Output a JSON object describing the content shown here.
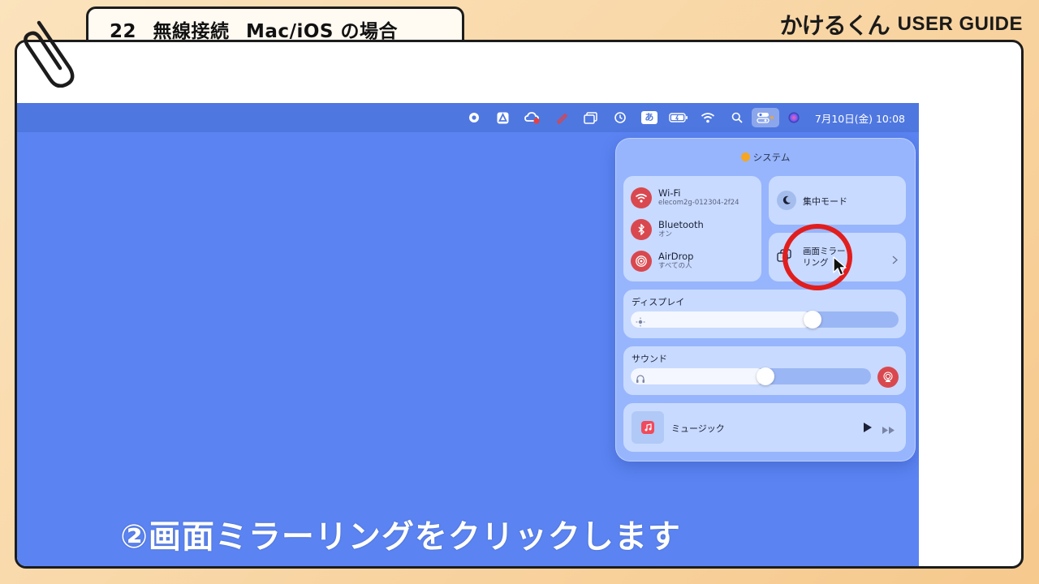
{
  "header": {
    "title": "22_ 無線接続 _Mac/iOS の場合",
    "brand_logo": "かけるくん",
    "brand_guide": "USER GUIDE"
  },
  "menubar": {
    "input_mode": "あ",
    "datetime": "7月10日(金)  10:08",
    "icons": [
      "record-icon",
      "drive-icon",
      "creative-cloud-icon",
      "pen-icon",
      "window-icon",
      "time-machine-icon",
      "input-method-icon",
      "battery-icon",
      "wifi-icon",
      "search-icon",
      "control-center-icon",
      "siri-icon"
    ]
  },
  "control_center": {
    "header": "システム",
    "network": [
      {
        "title": "Wi-Fi",
        "subtitle": "elecom2g-012304-2f24"
      },
      {
        "title": "Bluetooth",
        "subtitle": "オン"
      },
      {
        "title": "AirDrop",
        "subtitle": "すべての人"
      }
    ],
    "focus_label": "集中モード",
    "mirroring_label_line1": "画面ミラー",
    "mirroring_label_line2": "リング",
    "display_label": "ディスプレイ",
    "display_brightness": 0.68,
    "sound_label": "サウンド",
    "sound_volume": 0.56,
    "music_label": "ミュージック"
  },
  "caption": "②画面ミラーリングをクリックします",
  "colors": {
    "desktop": "#5b84f2",
    "accent_red": "#d9484f",
    "highlight_ring": "#e11e1e"
  }
}
